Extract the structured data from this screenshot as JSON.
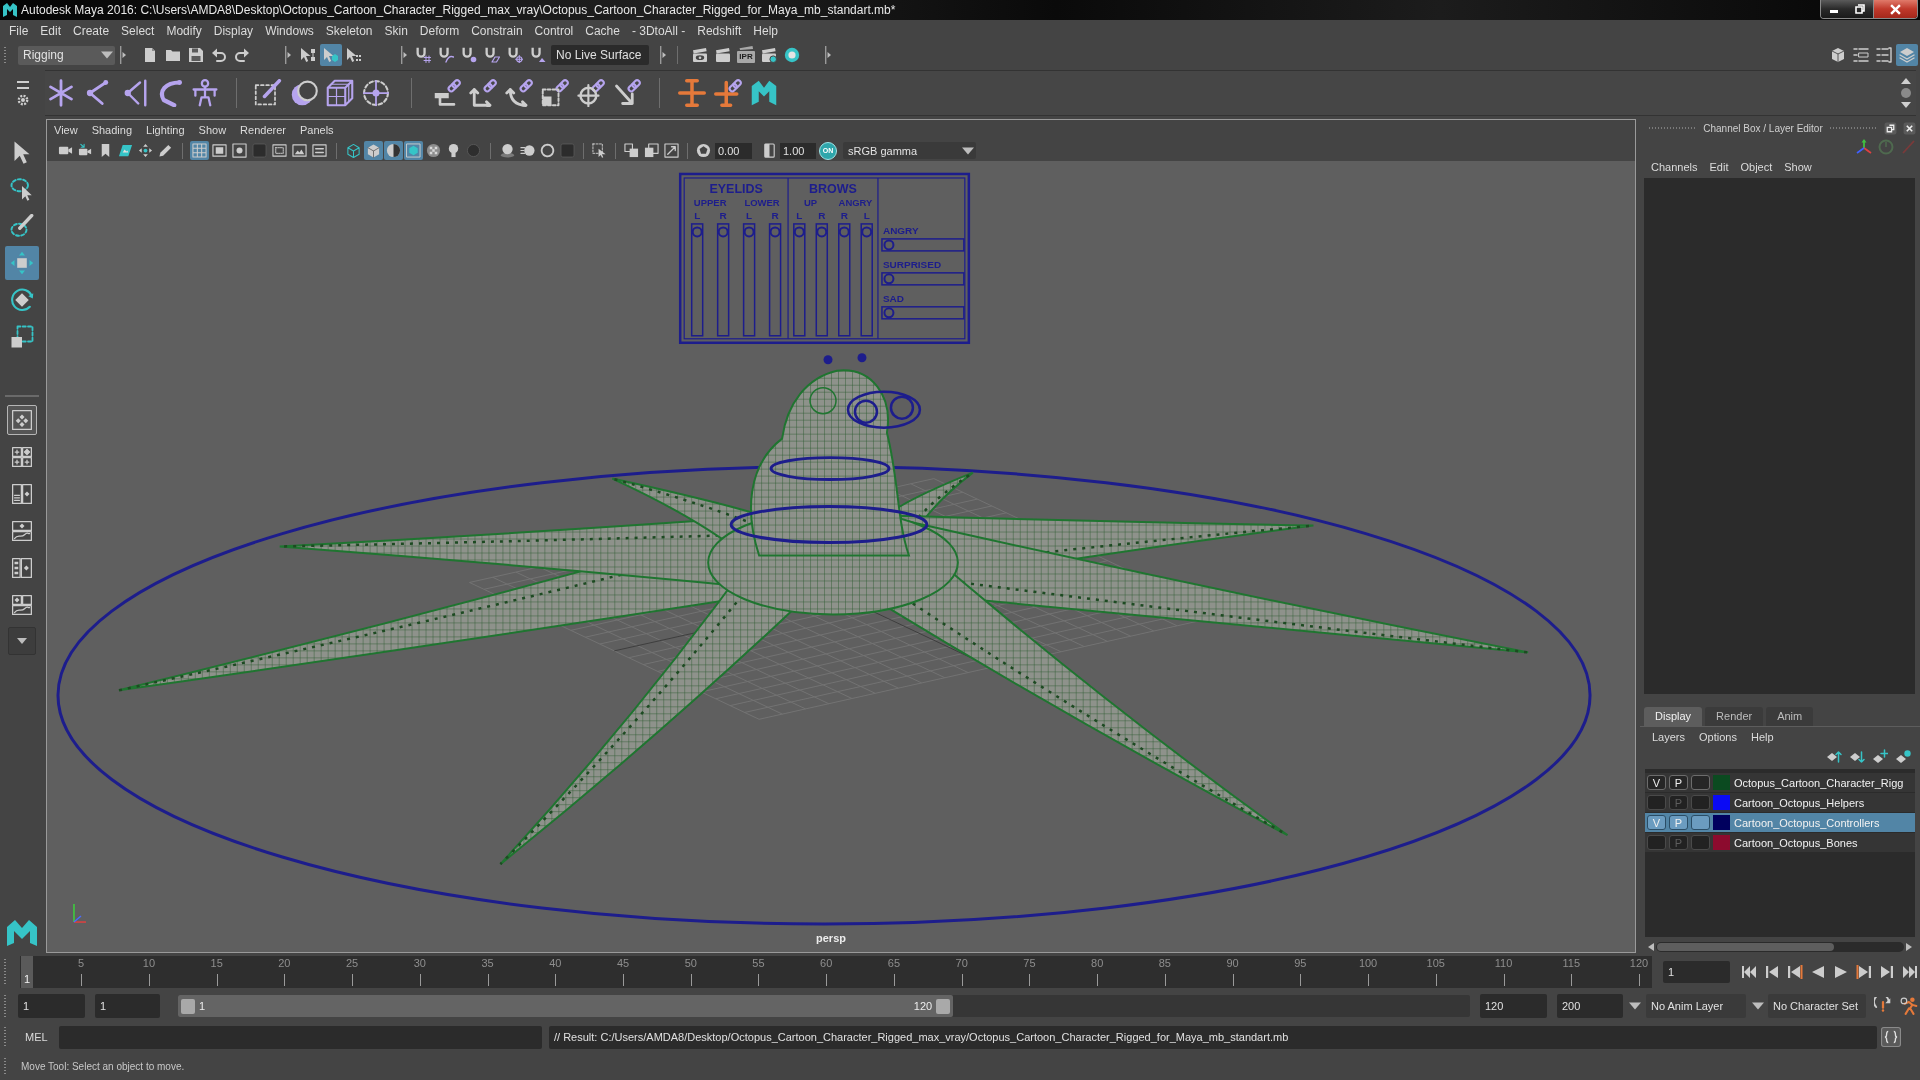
{
  "window": {
    "title": "Autodesk Maya 2016: C:\\Users\\AMDA8\\Desktop\\Octopus_Cartoon_Character_Rigged_max_vray\\Octopus_Cartoon_Character_Rigged_for_Maya_mb_standart.mb*"
  },
  "menu_bar": [
    "File",
    "Edit",
    "Create",
    "Select",
    "Modify",
    "Display",
    "Windows",
    "Skeleton",
    "Skin",
    "Deform",
    "Constrain",
    "Control",
    "Cache",
    "- 3DtoAll -",
    "Redshift",
    "Help"
  ],
  "status_line": {
    "menu_set": "Rigging",
    "file_tools": [
      {
        "kind": "file"
      },
      {
        "kind": "folder"
      },
      {
        "kind": "disk"
      },
      {
        "kind": "undo"
      },
      {
        "kind": "redo"
      }
    ],
    "selection_modes": [
      {
        "kind": "hierarchy",
        "selected": false
      },
      {
        "kind": "object",
        "selected": true
      },
      {
        "kind": "component",
        "selected": false
      }
    ],
    "snap_tools": [
      {
        "kind": "gridsnap"
      },
      {
        "kind": "curvesnap"
      },
      {
        "kind": "pointsnap"
      },
      {
        "kind": "planesnap"
      },
      {
        "kind": "centersnap"
      },
      {
        "kind": "magnet"
      }
    ],
    "live_surface": "No Live Surface",
    "render_tools": [
      {
        "kind": "eyeclapper"
      },
      {
        "kind": "clapper"
      },
      {
        "kind": "iprclapper",
        "label": "IPR"
      },
      {
        "kind": "gearclapper"
      },
      {
        "kind": "sphere"
      }
    ],
    "panel_toggles": [
      {
        "kind": "toolkit",
        "selected": false
      },
      {
        "kind": "attributes",
        "selected": false
      },
      {
        "kind": "toolsettings",
        "selected": false
      },
      {
        "kind": "layers",
        "selected": true
      }
    ]
  },
  "shelf": {
    "groups": [
      [
        {
          "kind": "joint"
        },
        {
          "kind": "ik"
        },
        {
          "kind": "ikspline"
        },
        {
          "kind": "curvejoint"
        },
        {
          "kind": "humanik"
        }
      ],
      [
        {
          "kind": "skinbind"
        },
        {
          "kind": "spherebind"
        },
        {
          "kind": "lattice"
        },
        {
          "kind": "cluster"
        }
      ],
      [
        {
          "kind": "parentcon"
        },
        {
          "kind": "pointcon"
        },
        {
          "kind": "orientcon"
        },
        {
          "kind": "scalecon"
        },
        {
          "kind": "aimcon"
        },
        {
          "kind": "polecon"
        }
      ],
      [
        {
          "kind": "cross"
        },
        {
          "kind": "crosslink"
        },
        {
          "kind": "mlogo"
        }
      ]
    ]
  },
  "toolbox": {
    "tools": [
      {
        "kind": "select",
        "selected": false
      },
      {
        "kind": "lasso",
        "selected": false
      },
      {
        "kind": "paint",
        "selected": false
      },
      {
        "kind": "move",
        "selected": true
      },
      {
        "kind": "rotate",
        "selected": false
      },
      {
        "kind": "scale",
        "selected": false
      }
    ],
    "layouts": [
      {
        "kind": "single",
        "selected": true
      },
      {
        "kind": "four",
        "selected": false
      },
      {
        "kind": "persplist",
        "selected": false
      },
      {
        "kind": "perspgraph",
        "selected": false
      },
      {
        "kind": "outliner",
        "selected": false
      },
      {
        "kind": "three",
        "selected": false
      }
    ]
  },
  "viewport": {
    "menus": [
      "View",
      "Shading",
      "Lighting",
      "Show",
      "Renderer",
      "Panels"
    ],
    "toolbar": {
      "groups": [
        [
          {
            "kind": "camera",
            "selected": false
          },
          {
            "kind": "camattr",
            "selected": false
          },
          {
            "kind": "bookmark",
            "selected": false
          },
          {
            "kind": "imageplane",
            "selected": false
          },
          {
            "kind": "pan2d",
            "selected": false
          },
          {
            "kind": "pencil",
            "selected": false
          }
        ],
        [
          {
            "kind": "grid",
            "selected": true
          },
          {
            "kind": "filmgate",
            "selected": false
          },
          {
            "kind": "resgate",
            "selected": false
          },
          {
            "kind": "gatemask",
            "selected": false
          },
          {
            "kind": "fieldchart",
            "selected": false
          },
          {
            "kind": "safeaction",
            "selected": false
          },
          {
            "kind": "safetitle",
            "selected": false
          }
        ],
        [
          {
            "kind": "wirecube",
            "selected": false
          },
          {
            "kind": "shadedcube",
            "selected": true
          },
          {
            "kind": "textured",
            "selected": true
          },
          {
            "kind": "wireonshaded",
            "selected": true
          },
          {
            "kind": "xray",
            "selected": false
          },
          {
            "kind": "bulb",
            "selected": false
          },
          {
            "kind": "shadow",
            "selected": false
          }
        ],
        [
          {
            "kind": "ao",
            "selected": false
          },
          {
            "kind": "motionblur",
            "selected": false
          },
          {
            "kind": "aa",
            "selected": false
          },
          {
            "kind": "dark",
            "selected": false
          }
        ],
        [
          {
            "kind": "isolate",
            "selected": false
          }
        ],
        [
          {
            "kind": "xrayjoint",
            "selected": false
          },
          {
            "kind": "xraycomp",
            "selected": false
          },
          {
            "kind": "hud",
            "selected": false
          }
        ]
      ],
      "exposure": "0.00",
      "gamma": "1.00",
      "color_management": {
        "label": "ON",
        "selected": true
      },
      "view_transform": "sRGB gamma"
    },
    "face_board": {
      "sections": [
        {
          "title": "EYELIDS",
          "columns": [
            {
              "label": "UPPER",
              "sides": [
                {
                  "label": "L",
                  "level": 1
                },
                {
                  "label": "R",
                  "level": 1
                }
              ]
            },
            {
              "label": "LOWER",
              "sides": [
                {
                  "label": "L",
                  "level": 1
                },
                {
                  "label": "R",
                  "level": 1
                }
              ]
            }
          ]
        },
        {
          "title": "BROWS",
          "columns": [
            {
              "label": "UP",
              "sides": [
                {
                  "label": "L",
                  "level": 1
                },
                {
                  "label": "R",
                  "level": 1
                }
              ]
            },
            {
              "label": "ANGRY",
              "sides": [
                {
                  "label": "R",
                  "level": 1
                },
                {
                  "label": "L",
                  "level": 1
                }
              ]
            }
          ]
        }
      ],
      "expressions": [
        {
          "label": "ANGRY",
          "level": 0
        },
        {
          "label": "SURPRISED",
          "level": 0
        },
        {
          "label": "SAD",
          "level": 0
        }
      ]
    },
    "camera": "persp"
  },
  "channel_box": {
    "title": "Channel Box / Layer Editor",
    "menus": [
      "Channels",
      "Edit",
      "Object",
      "Show"
    ]
  },
  "layer_editor": {
    "tabs": [
      {
        "label": "Display",
        "selected": true
      },
      {
        "label": "Render",
        "selected": false
      },
      {
        "label": "Anim",
        "selected": false
      }
    ],
    "menus": [
      "Layers",
      "Options",
      "Help"
    ],
    "tools": [
      {
        "kind": "layerup"
      },
      {
        "kind": "layerdown"
      },
      {
        "kind": "newlayer"
      },
      {
        "kind": "newlayersel"
      }
    ],
    "layers": [
      {
        "name": "Octopus_Cartoon_Character_Rigg",
        "color": "#0b4a20",
        "visible": true,
        "visibility_label": "V",
        "playback_label": "P",
        "selected": false
      },
      {
        "name": "Cartoon_Octopus_Helpers",
        "color": "#0a0af5",
        "visible": false,
        "playback_label": "P",
        "selected": false
      },
      {
        "name": "Cartoon_Octopus_Controllers",
        "color": "#00005e",
        "visible": true,
        "visibility_label": "V",
        "playback_label": "P",
        "selected": true
      },
      {
        "name": "Cartoon_Octopus_Bones",
        "color": "#8c0b2e",
        "visible": false,
        "playback_label": "P",
        "selected": false
      }
    ]
  },
  "time_slider": {
    "ticks": [
      "5",
      "10",
      "15",
      "20",
      "25",
      "30",
      "35",
      "40",
      "45",
      "50",
      "55",
      "60",
      "65",
      "70",
      "75",
      "80",
      "85",
      "90",
      "95",
      "100",
      "105",
      "110",
      "115",
      "120"
    ],
    "level": 0,
    "current_frame": "1",
    "frame_field": "1",
    "playback": [
      {
        "kind": "tostart"
      },
      {
        "kind": "stepback"
      },
      {
        "kind": "prevkey"
      },
      {
        "kind": "playback"
      },
      {
        "kind": "play"
      },
      {
        "kind": "nextkey"
      },
      {
        "kind": "stepfwd"
      },
      {
        "kind": "toend"
      }
    ]
  },
  "range_slider": {
    "start": "1",
    "playback_start": "1",
    "range_start": "1",
    "range_end": "120",
    "level": 0.6,
    "playback_end": "120",
    "end": "200",
    "anim_layer": "No Anim Layer",
    "character_set": "No Character Set",
    "tools": [
      {
        "kind": "autokey"
      },
      {
        "kind": "animprefs"
      }
    ]
  },
  "command_line": {
    "language": "MEL",
    "result": "// Result: C:/Users/AMDA8/Desktop/Octopus_Cartoon_Character_Rigged_max_vray/Octopus_Cartoon_Character_Rigged_for_Maya_mb_standart.mb"
  },
  "help_line": "Move Tool: Select an object to move."
}
